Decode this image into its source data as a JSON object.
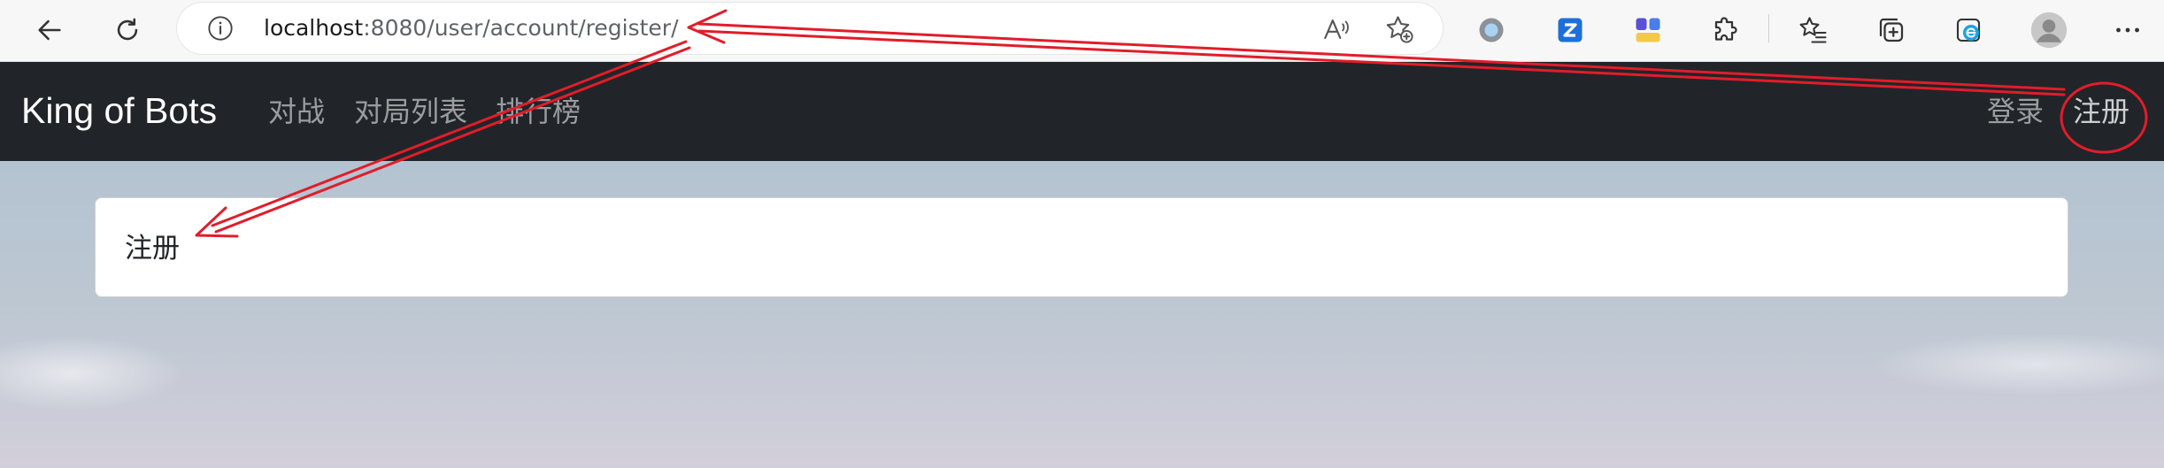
{
  "browser": {
    "address": {
      "host": "localhost",
      "path": ":8080/user/account/register/"
    }
  },
  "navbar": {
    "brand": "King of Bots",
    "links": [
      {
        "label": "对战"
      },
      {
        "label": "对局列表"
      },
      {
        "label": "排行榜"
      }
    ],
    "right_links": [
      {
        "label": "登录"
      },
      {
        "label": "注册"
      }
    ]
  },
  "card": {
    "body": "注册"
  },
  "colors": {
    "navbar_bg": "#212529",
    "annotation_red": "#e11d2a"
  },
  "icons": [
    "back-arrow-icon",
    "refresh-icon",
    "info-icon",
    "read-aloud-icon",
    "add-favorite-icon",
    "extension-circle-icon",
    "z-extension-icon",
    "grid-extension-icon",
    "extensions-puzzle-icon",
    "favorites-icon",
    "collections-icon",
    "ie-mode-icon",
    "profile-avatar-icon",
    "more-menu-icon"
  ]
}
